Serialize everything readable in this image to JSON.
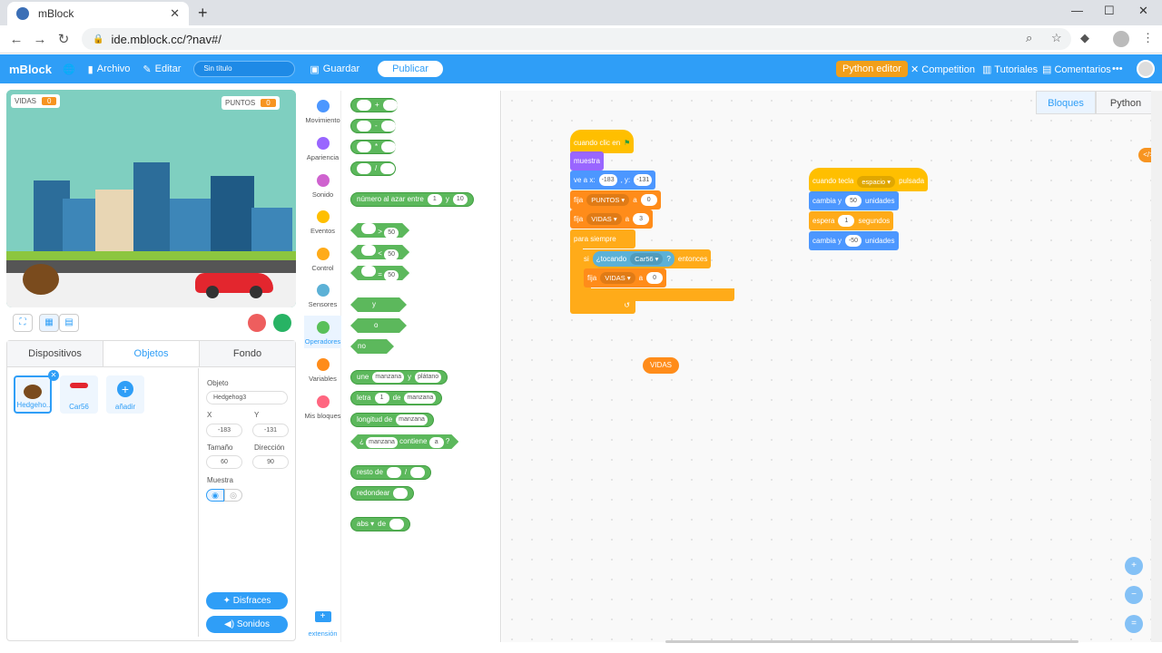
{
  "browser": {
    "tab_title": "mBlock",
    "url": "ide.mblock.cc/?nav#/"
  },
  "topbar": {
    "logo": "mBlock",
    "file": "Archivo",
    "edit": "Editar",
    "project_name": "Sin título",
    "save": "Guardar",
    "publish": "Publicar",
    "python_editor": "Python editor",
    "competition": "Competition",
    "tutorials": "Tutoriales",
    "comments": "Comentarios",
    "more": "•••"
  },
  "stage": {
    "vidas_label": "VIDAS",
    "vidas_value": "0",
    "puntos_label": "PUNTOS",
    "puntos_value": "0"
  },
  "lower_tabs": [
    "Dispositivos",
    "Objetos",
    "Fondo"
  ],
  "sprites": [
    {
      "label": "Hedgeho..."
    },
    {
      "label": "Car56"
    },
    {
      "label": "añadir"
    }
  ],
  "sprite_props": {
    "object_label": "Objeto",
    "object_value": "Hedgehog3",
    "x_label": "X",
    "x_value": "-183",
    "y_label": "Y",
    "y_value": "-131",
    "size_label": "Tamaño",
    "size_value": "60",
    "direction_label": "Dirección",
    "direction_value": "90",
    "show_label": "Muestra",
    "costumes": "Disfraces",
    "sounds": "Sonidos"
  },
  "categories": [
    {
      "label": "Movimiento",
      "color": "#4c97ff"
    },
    {
      "label": "Apariencia",
      "color": "#9966ff"
    },
    {
      "label": "Sonido",
      "color": "#cf63cf"
    },
    {
      "label": "Eventos",
      "color": "#ffbf00"
    },
    {
      "label": "Control",
      "color": "#ffab19"
    },
    {
      "label": "Sensores",
      "color": "#5cb1d6"
    },
    {
      "label": "Operadores",
      "color": "#59c059"
    },
    {
      "label": "Variables",
      "color": "#ff8c1a"
    },
    {
      "label": "Mis bloques",
      "color": "#ff6680"
    }
  ],
  "extension_label": "extensión",
  "palette": {
    "random": "número al azar entre",
    "random_a": "1",
    "random_y": "y",
    "random_b": "10",
    "gt_val": "50",
    "lt_val": "50",
    "eq_val": "50",
    "and": "y",
    "or": "o",
    "not": "no",
    "join": "une",
    "join_a": "manzana",
    "join_y": "y",
    "join_b": "plátano",
    "letter": "letra",
    "letter_n": "1",
    "letter_de": "de",
    "letter_word": "manzana",
    "length": "longitud de",
    "length_word": "manzana",
    "contains_q": "¿",
    "contains_word": "manzana",
    "contains": "contiene",
    "contains_char": "a",
    "contains_end": "?",
    "mod": "resto de",
    "round": "redondear",
    "abs": "abs ▾",
    "abs_de": "de"
  },
  "script1": {
    "when_flag": "cuando clic en",
    "show": "muestra",
    "goto": "ve a x:",
    "goto_x": "-183",
    "goto_y_label": ", y:",
    "goto_y": "-131",
    "set1": "fija",
    "set1_var": "PUNTOS ▾",
    "set1_a": "a",
    "set1_val": "0",
    "set2": "fija",
    "set2_var": "VIDAS ▾",
    "set2_a": "a",
    "set2_val": "3",
    "forever": "para siempre",
    "if": "si",
    "touching": "¿tocando",
    "touching_obj": "Car56 ▾",
    "touching_q": "?",
    "then": "entonces",
    "set3": "fija",
    "set3_var": "VIDAS ▾",
    "set3_a": "a",
    "set3_val": "0"
  },
  "script2": {
    "when_key": "cuando tecla",
    "key": "espacio ▾",
    "pressed": "pulsada",
    "change1": "cambia y",
    "change1_val": "50",
    "change1_units": "unidades",
    "wait": "espera",
    "wait_val": "1",
    "wait_units": "segundos",
    "change2": "cambia y",
    "change2_val": "-50",
    "change2_units": "unidades"
  },
  "loose_reporter": "VIDAS",
  "workspace_tabs": [
    "Bloques",
    "Python"
  ]
}
